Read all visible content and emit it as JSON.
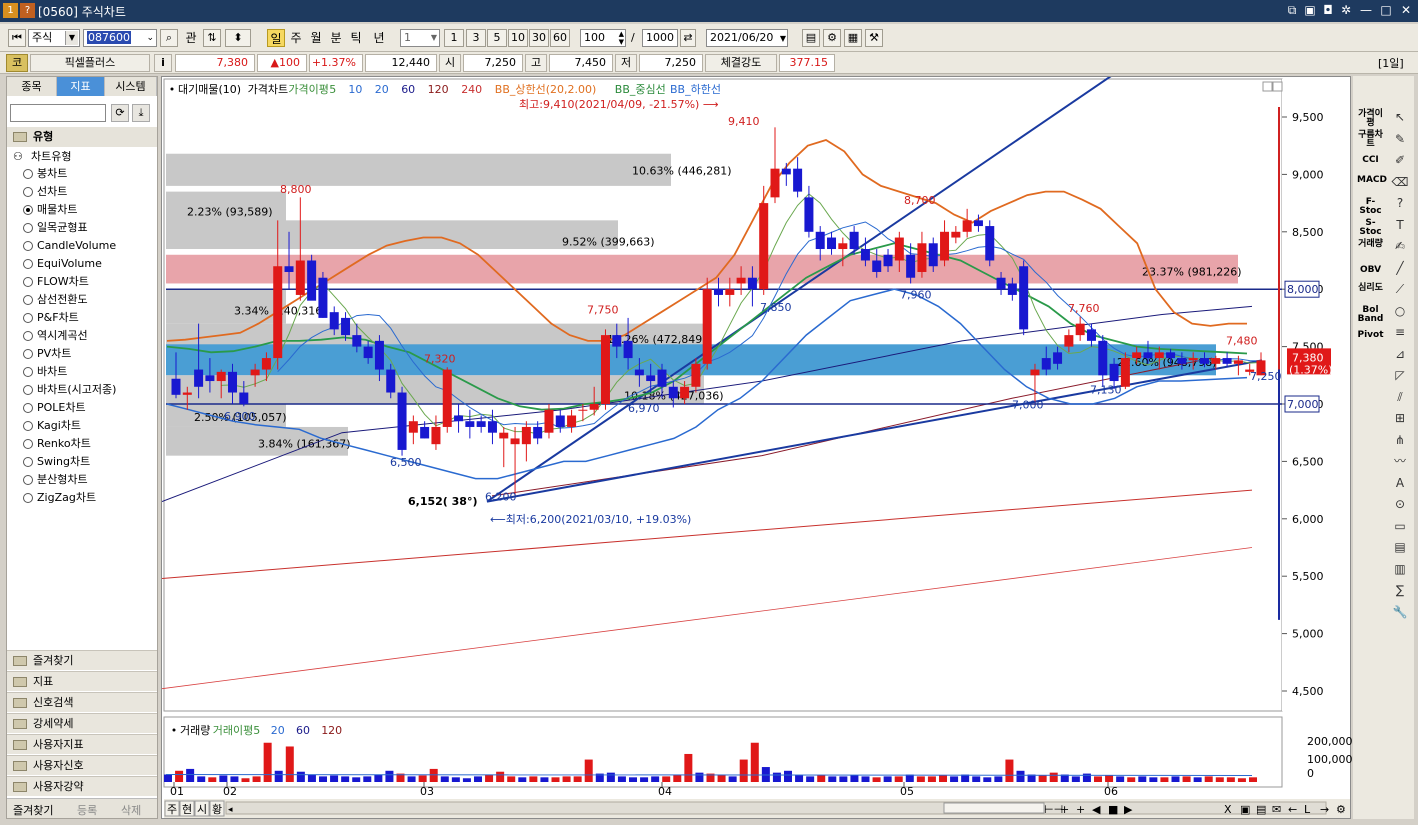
{
  "window": {
    "id_badge": "1",
    "help_badge": "?",
    "title": "[0560] 주식차트"
  },
  "toolbar": {
    "market": "주식",
    "code": "087600",
    "btn_gwan": "관",
    "periods": [
      "일",
      "주",
      "월",
      "분",
      "틱",
      "년"
    ],
    "period_active": "일",
    "count": "1",
    "shortcuts": [
      "1",
      "3",
      "5",
      "10",
      "30",
      "60"
    ],
    "bars": "100",
    "slash": "/",
    "total": "1000",
    "date": "2021/06/20"
  },
  "quote": {
    "badge": "코",
    "name": "픽셀플러스",
    "info": "i",
    "price": "7,380",
    "change": "▲100",
    "pct": "+1.37%",
    "volume": "12,440",
    "open_l": "시",
    "open": "7,250",
    "high_l": "고",
    "high": "7,450",
    "low_l": "저",
    "low": "7,250",
    "strength_l": "체결강도",
    "strength": "377.15",
    "period_tag": "[1일]"
  },
  "left": {
    "tabs": [
      "종목",
      "지표",
      "시스템"
    ],
    "active_tab": "지표",
    "section": "유형",
    "tree": "차트유형",
    "types": [
      "봉차트",
      "선차트",
      "매물차트",
      "일목균형표",
      "CandleVolume",
      "EquiVolume",
      "FLOW차트",
      "삼선전환도",
      "P&F차트",
      "역시계곡선",
      "PV차트",
      "바차트",
      "바차트(시고저종)",
      "POLE차트",
      "Kagi차트",
      "Renko차트",
      "Swing차트",
      "분산형차트",
      "ZigZag차트"
    ],
    "selected": "매물차트",
    "groups": [
      "즐겨찾기",
      "지표",
      "신호검색",
      "강세약세",
      "사용자지표",
      "사용자신호",
      "사용자강약"
    ],
    "bottom_tabs": [
      "즐겨찾기",
      "등록",
      "삭제"
    ]
  },
  "chart": {
    "legend": [
      {
        "label": "대기매물(10)",
        "color": "#000000"
      },
      {
        "label": "가격차트",
        "color": "#000000"
      },
      {
        "label": "가격이평",
        "color": "#3a8f3a"
      },
      {
        "label": "5",
        "color": "#3a8f3a"
      },
      {
        "label": "10",
        "color": "#2a6ad0"
      },
      {
        "label": "20",
        "color": "#2a6ad0"
      },
      {
        "label": "60",
        "color": "#1a1a8a"
      },
      {
        "label": "120",
        "color": "#8a1a1a"
      },
      {
        "label": "240",
        "color": "#c83030"
      },
      {
        "label": "BB_상한선(20,2.00)",
        "color": "#e07020"
      },
      {
        "label": "BB_중심선",
        "color": "#2a8a3a"
      },
      {
        "label": "BB_하한선",
        "color": "#2a6ad0"
      }
    ],
    "yticks": [
      "9,500",
      "9,000",
      "8,500",
      "8,000",
      "7,500",
      "7,000",
      "6,500",
      "6,000",
      "5,500",
      "5,000",
      "4,500"
    ],
    "months": [
      "01",
      "02",
      "03",
      "04",
      "05",
      "06"
    ],
    "max_note": "최고:9,410(2021/04/09, -21.57%)",
    "min_note": "최저:6,200(2021/03/10, +19.03%)",
    "hline_left": "8,000",
    "hline_right": "7,000",
    "price_tag": "7,380",
    "pct_tag": "(1.37%)",
    "trend_label": "6,152( 38°)",
    "volume_profile": [
      {
        "label": "10.63% (446,281)"
      },
      {
        "label": "2.23% (93,589)"
      },
      {
        "label": "9.52% (399,663)"
      },
      {
        "label": "23.37% (981,226)",
        "highlight": "red"
      },
      {
        "label": "3.34% (140,316)"
      },
      {
        "label": "11.26% (472,849)"
      },
      {
        "label": "22.60% (948,798)",
        "highlight": "blue"
      },
      {
        "label": "10.18% (427,036)"
      },
      {
        "label": "2.50% (105,057)"
      },
      {
        "label": "3.84% (161,367)"
      }
    ],
    "annotations": [
      "8,800",
      "9,410",
      "8,700",
      "7,750",
      "7,320",
      "6,900",
      "6,500",
      "6,200",
      "6,970",
      "7,850",
      "7,960",
      "7,760",
      "7,480",
      "7,000",
      "7,130",
      "7,250"
    ],
    "candles": [
      {
        "d": "12/28",
        "o": 7220,
        "h": 7450,
        "l": 7050,
        "c": 7080
      },
      {
        "d": "12/29",
        "o": 7080,
        "h": 7150,
        "l": 6950,
        "c": 7100
      },
      {
        "d": "12/30",
        "o": 7300,
        "h": 7700,
        "l": 7050,
        "c": 7150
      },
      {
        "d": "01/04",
        "o": 7250,
        "h": 7400,
        "l": 7100,
        "c": 7200
      },
      {
        "d": "01/05",
        "o": 7200,
        "h": 7300,
        "l": 7050,
        "c": 7280
      },
      {
        "d": "01/06",
        "o": 7280,
        "h": 7350,
        "l": 7000,
        "c": 7100
      },
      {
        "d": "01/07",
        "o": 7100,
        "h": 7200,
        "l": 6980,
        "c": 7000
      },
      {
        "d": "01/08",
        "o": 7250,
        "h": 7350,
        "l": 7150,
        "c": 7300
      },
      {
        "d": "01/11",
        "o": 7300,
        "h": 7450,
        "l": 7200,
        "c": 7400
      },
      {
        "d": "01/12",
        "o": 7400,
        "h": 8600,
        "l": 7300,
        "c": 8200
      },
      {
        "d": "01/13",
        "o": 8200,
        "h": 8500,
        "l": 8000,
        "c": 8150
      },
      {
        "d": "01/14",
        "o": 7950,
        "h": 8800,
        "l": 7900,
        "c": 8250
      },
      {
        "d": "01/15",
        "o": 8250,
        "h": 8300,
        "l": 7950,
        "c": 7900
      },
      {
        "d": "01/18",
        "o": 8100,
        "h": 8150,
        "l": 7750,
        "c": 7750
      },
      {
        "d": "01/19",
        "o": 7800,
        "h": 7850,
        "l": 7600,
        "c": 7650
      },
      {
        "d": "01/20",
        "o": 7750,
        "h": 7800,
        "l": 7550,
        "c": 7600
      },
      {
        "d": "01/21",
        "o": 7600,
        "h": 7700,
        "l": 7450,
        "c": 7500
      },
      {
        "d": "01/22",
        "o": 7500,
        "h": 7550,
        "l": 7350,
        "c": 7400
      },
      {
        "d": "01/25",
        "o": 7550,
        "h": 7600,
        "l": 7200,
        "c": 7300
      },
      {
        "d": "01/26",
        "o": 7300,
        "h": 7350,
        "l": 7050,
        "c": 7100
      },
      {
        "d": "01/27",
        "o": 7100,
        "h": 7150,
        "l": 6550,
        "c": 6600
      },
      {
        "d": "01/28",
        "o": 6750,
        "h": 6900,
        "l": 6650,
        "c": 6850
      },
      {
        "d": "01/29",
        "o": 6800,
        "h": 6850,
        "l": 6700,
        "c": 6700
      },
      {
        "d": "02/01",
        "o": 6650,
        "h": 6900,
        "l": 6600,
        "c": 6800
      },
      {
        "d": "02/02",
        "o": 6800,
        "h": 7320,
        "l": 6750,
        "c": 7300
      },
      {
        "d": "02/03",
        "o": 6900,
        "h": 7000,
        "l": 6750,
        "c": 6850
      },
      {
        "d": "02/04",
        "o": 6850,
        "h": 6950,
        "l": 6700,
        "c": 6800
      },
      {
        "d": "02/05",
        "o": 6850,
        "h": 6900,
        "l": 6750,
        "c": 6800
      },
      {
        "d": "02/08",
        "o": 6850,
        "h": 6950,
        "l": 6650,
        "c": 6750
      },
      {
        "d": "02/09",
        "o": 6700,
        "h": 6800,
        "l": 6450,
        "c": 6750
      },
      {
        "d": "02/10",
        "o": 6650,
        "h": 6800,
        "l": 6200,
        "c": 6700
      },
      {
        "d": "02/15",
        "o": 6650,
        "h": 6850,
        "l": 6500,
        "c": 6800
      },
      {
        "d": "02/16",
        "o": 6800,
        "h": 6850,
        "l": 6650,
        "c": 6700
      },
      {
        "d": "02/17",
        "o": 6750,
        "h": 7000,
        "l": 6700,
        "c": 6950
      },
      {
        "d": "02/18",
        "o": 6900,
        "h": 6950,
        "l": 6750,
        "c": 6800
      },
      {
        "d": "02/19",
        "o": 6800,
        "h": 6950,
        "l": 6750,
        "c": 6900
      },
      {
        "d": "02/22",
        "o": 6950,
        "h": 7000,
        "l": 6850,
        "c": 6950
      },
      {
        "d": "02/23",
        "o": 6950,
        "h": 7150,
        "l": 6900,
        "c": 7000
      },
      {
        "d": "02/24",
        "o": 7000,
        "h": 7650,
        "l": 6950,
        "c": 7600
      },
      {
        "d": "02/25",
        "o": 7600,
        "h": 7700,
        "l": 7400,
        "c": 7500
      },
      {
        "d": "02/26",
        "o": 7550,
        "h": 7750,
        "l": 7300,
        "c": 7400
      },
      {
        "d": "03/02",
        "o": 7300,
        "h": 7400,
        "l": 7150,
        "c": 7250
      },
      {
        "d": "03/03",
        "o": 7250,
        "h": 7350,
        "l": 7100,
        "c": 7200
      },
      {
        "d": "03/04",
        "o": 7300,
        "h": 7350,
        "l": 7050,
        "c": 7150
      },
      {
        "d": "03/05",
        "o": 7150,
        "h": 7200,
        "l": 6970,
        "c": 7050
      },
      {
        "d": "03/08",
        "o": 7050,
        "h": 7200,
        "l": 7000,
        "c": 7150
      },
      {
        "d": "03/09",
        "o": 7150,
        "h": 7400,
        "l": 7100,
        "c": 7350
      },
      {
        "d": "03/10",
        "o": 7350,
        "h": 8100,
        "l": 7300,
        "c": 8000
      },
      {
        "d": "03/11",
        "o": 8000,
        "h": 8100,
        "l": 7850,
        "c": 7950
      },
      {
        "d": "03/12",
        "o": 7950,
        "h": 8100,
        "l": 7850,
        "c": 8000
      },
      {
        "d": "03/15",
        "o": 8050,
        "h": 8200,
        "l": 7950,
        "c": 8100
      },
      {
        "d": "03/16",
        "o": 8100,
        "h": 8200,
        "l": 7850,
        "c": 8000
      },
      {
        "d": "03/17",
        "o": 8000,
        "h": 8900,
        "l": 7950,
        "c": 8750
      },
      {
        "d": "03/18",
        "o": 8800,
        "h": 9410,
        "l": 8750,
        "c": 9050
      },
      {
        "d": "03/19",
        "o": 9050,
        "h": 9100,
        "l": 8900,
        "c": 9000
      },
      {
        "d": "03/22",
        "o": 9050,
        "h": 9150,
        "l": 8800,
        "c": 8850
      },
      {
        "d": "03/23",
        "o": 8800,
        "h": 8900,
        "l": 8450,
        "c": 8500
      },
      {
        "d": "03/24",
        "o": 8500,
        "h": 8550,
        "l": 8250,
        "c": 8350
      },
      {
        "d": "03/25",
        "o": 8450,
        "h": 8500,
        "l": 8300,
        "c": 8350
      },
      {
        "d": "03/26",
        "o": 8350,
        "h": 8450,
        "l": 8200,
        "c": 8400
      },
      {
        "d": "03/29",
        "o": 8500,
        "h": 8550,
        "l": 8300,
        "c": 8350
      },
      {
        "d": "03/30",
        "o": 8350,
        "h": 8450,
        "l": 8200,
        "c": 8250
      },
      {
        "d": "03/31",
        "o": 8250,
        "h": 8350,
        "l": 8100,
        "c": 8150
      },
      {
        "d": "04/01",
        "o": 8300,
        "h": 8350,
        "l": 8150,
        "c": 8200
      },
      {
        "d": "04/02",
        "o": 8250,
        "h": 8500,
        "l": 8150,
        "c": 8450
      },
      {
        "d": "04/05",
        "o": 8300,
        "h": 8400,
        "l": 8050,
        "c": 8100
      },
      {
        "d": "04/06",
        "o": 8150,
        "h": 8500,
        "l": 8100,
        "c": 8400
      },
      {
        "d": "04/07",
        "o": 8400,
        "h": 8450,
        "l": 8150,
        "c": 8200
      },
      {
        "d": "04/08",
        "o": 8250,
        "h": 8600,
        "l": 8200,
        "c": 8500
      },
      {
        "d": "04/09",
        "o": 8450,
        "h": 8550,
        "l": 8400,
        "c": 8500
      },
      {
        "d": "04/12",
        "o": 8500,
        "h": 8700,
        "l": 8450,
        "c": 8600
      },
      {
        "d": "04/13",
        "o": 8600,
        "h": 8650,
        "l": 8500,
        "c": 8550
      },
      {
        "d": "04/14",
        "o": 8550,
        "h": 8600,
        "l": 8200,
        "c": 8250
      },
      {
        "d": "04/15",
        "o": 8100,
        "h": 8150,
        "l": 7950,
        "c": 8000
      },
      {
        "d": "04/16",
        "o": 8050,
        "h": 8100,
        "l": 7900,
        "c": 7950
      },
      {
        "d": "04/19",
        "o": 8200,
        "h": 8250,
        "l": 7600,
        "c": 7650
      },
      {
        "d": "04/20",
        "o": 7250,
        "h": 7350,
        "l": 6990,
        "c": 7300
      },
      {
        "d": "04/21",
        "o": 7400,
        "h": 7500,
        "l": 7250,
        "c": 7300
      },
      {
        "d": "04/22",
        "o": 7450,
        "h": 7500,
        "l": 7300,
        "c": 7350
      },
      {
        "d": "04/23",
        "o": 7500,
        "h": 7650,
        "l": 7450,
        "c": 7600
      },
      {
        "d": "04/26",
        "o": 7600,
        "h": 7760,
        "l": 7550,
        "c": 7700
      },
      {
        "d": "04/27",
        "o": 7650,
        "h": 7700,
        "l": 7500,
        "c": 7550
      },
      {
        "d": "04/28",
        "o": 7550,
        "h": 7600,
        "l": 7150,
        "c": 7250
      },
      {
        "d": "04/29",
        "o": 7350,
        "h": 7400,
        "l": 7130,
        "c": 7200
      },
      {
        "d": "04/30",
        "o": 7150,
        "h": 7450,
        "l": 7130,
        "c": 7400
      },
      {
        "d": "05/03",
        "o": 7400,
        "h": 7500,
        "l": 7350,
        "c": 7450
      },
      {
        "d": "05/04",
        "o": 7450,
        "h": 7550,
        "l": 7350,
        "c": 7400
      },
      {
        "d": "05/06",
        "o": 7400,
        "h": 7500,
        "l": 7300,
        "c": 7450
      },
      {
        "d": "05/07",
        "o": 7450,
        "h": 7480,
        "l": 7350,
        "c": 7400
      },
      {
        "d": "05/10",
        "o": 7400,
        "h": 7450,
        "l": 7300,
        "c": 7350
      },
      {
        "d": "05/11",
        "o": 7380,
        "h": 7450,
        "l": 7300,
        "c": 7400
      },
      {
        "d": "05/12",
        "o": 7400,
        "h": 7450,
        "l": 7320,
        "c": 7350
      },
      {
        "d": "05/13",
        "o": 7350,
        "h": 7420,
        "l": 7300,
        "c": 7400
      },
      {
        "d": "05/14",
        "o": 7400,
        "h": 7450,
        "l": 7320,
        "c": 7350
      },
      {
        "d": "05/17",
        "o": 7350,
        "h": 7420,
        "l": 7250,
        "c": 7380
      },
      {
        "d": "05/18",
        "o": 7280,
        "h": 7350,
        "l": 7250,
        "c": 7300
      },
      {
        "d": "05/20",
        "o": 7250,
        "h": 7450,
        "l": 7250,
        "c": 7380
      }
    ],
    "bb_upper": [
      7550,
      7560,
      7580,
      7600,
      7620,
      7700,
      7800,
      7900,
      8000,
      8100,
      8200,
      8300,
      8380,
      8420,
      8450,
      8450,
      8400,
      8300,
      8150,
      8000,
      7850,
      7700,
      7600,
      7550,
      7550,
      7600,
      7700,
      7800,
      7900,
      8000,
      8100,
      8300,
      8600,
      8900,
      9100,
      9250,
      9300,
      9200,
      9000,
      8900,
      8850,
      8800,
      8750,
      8650,
      8580,
      8680,
      8750,
      8820,
      8850,
      8850,
      8780,
      8700,
      8550,
      8400,
      8000,
      7800,
      7700,
      7680,
      7700,
      7700
    ],
    "bb_mid": [
      7500,
      7480,
      7450,
      7460,
      7500,
      7550,
      7550,
      7560,
      7580,
      7560,
      7500,
      7450,
      7350,
      7250,
      7150,
      7050,
      6980,
      6950,
      6960,
      7000,
      7020,
      7050,
      7100,
      7200,
      7350,
      7500,
      7650,
      7800,
      7950,
      8100,
      8200,
      8300,
      8350,
      8400,
      8350,
      8300,
      8250,
      8150,
      8050,
      7950,
      7850,
      7700,
      7600,
      7550,
      7500,
      7480,
      7470,
      7460,
      7450,
      7440
    ],
    "bb_lower": [
      7000,
      6950,
      6900,
      6850,
      6820,
      6800,
      6780,
      6700,
      6650,
      6600,
      6550,
      6500,
      6450,
      6400,
      6350,
      6350,
      6400,
      6450,
      6500,
      6500,
      6550,
      6600,
      6650,
      6700,
      6800,
      6950,
      7050,
      7200,
      7400,
      7600,
      7750,
      7900,
      7950,
      8000,
      7950,
      7850,
      7700,
      7500,
      7300,
      7150,
      7050,
      7000,
      7000,
      7050,
      7150,
      7200,
      7200,
      7210,
      7220,
      7230
    ]
  },
  "volume": {
    "legend": [
      {
        "label": "거래량",
        "color": "#000000"
      },
      {
        "label": "거래이평",
        "color": "#3a8f3a"
      },
      {
        "label": "5",
        "color": "#3a8f3a"
      },
      {
        "label": "20",
        "color": "#2a6ad0"
      },
      {
        "label": "60",
        "color": "#1a1a8a"
      },
      {
        "label": "120",
        "color": "#8a1a1a"
      }
    ],
    "yticks": [
      "200,000",
      "100,000",
      "0"
    ],
    "values": [
      40,
      60,
      70,
      30,
      25,
      35,
      30,
      20,
      30,
      210,
      60,
      190,
      55,
      40,
      30,
      35,
      30,
      25,
      30,
      40,
      60,
      45,
      30,
      35,
      70,
      30,
      25,
      20,
      30,
      40,
      55,
      30,
      25,
      30,
      25,
      25,
      30,
      30,
      120,
      45,
      50,
      30,
      25,
      25,
      30,
      30,
      40,
      150,
      50,
      45,
      40,
      30,
      120,
      210,
      80,
      50,
      60,
      35,
      30,
      35,
      30,
      30,
      35,
      30,
      25,
      30,
      30,
      40,
      30,
      30,
      35,
      30,
      40,
      30,
      25,
      30,
      120,
      60,
      40,
      35,
      50,
      40,
      30,
      45,
      30,
      35,
      30,
      25,
      30,
      25,
      25,
      30,
      30,
      25,
      30,
      25,
      25,
      20,
      25
    ]
  },
  "bottom_bar": {
    "labels": [
      "주",
      "현",
      "시",
      "황"
    ]
  },
  "right_tools": [
    "가격이평",
    "구름차트",
    "CCI",
    "MACD",
    "F-Stoc",
    "S-Stoc",
    "거래량",
    "OBV",
    "심리도",
    "Bol Band",
    "Pivot"
  ]
}
